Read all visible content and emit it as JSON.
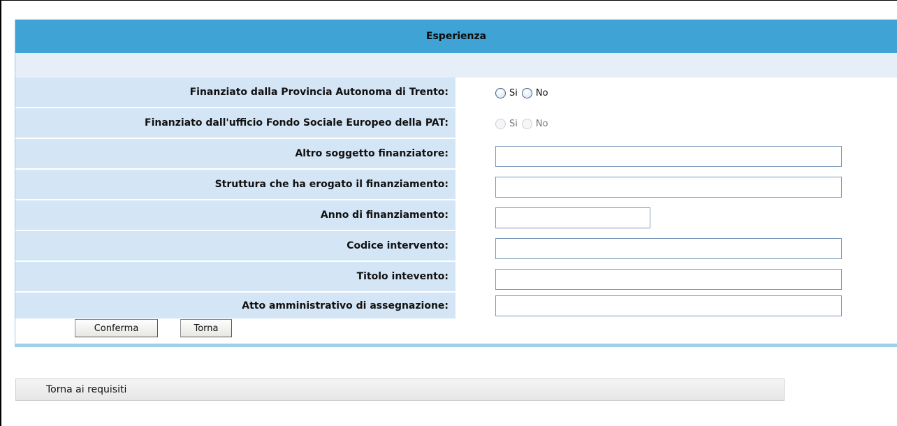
{
  "section": {
    "title": "Esperienza"
  },
  "fields": [
    {
      "label": "Finanziato dalla Provincia Autonoma di Trento:",
      "type": "radio",
      "options": [
        "Si",
        "No"
      ],
      "enabled": true
    },
    {
      "label": "Finanziato dall'ufficio Fondo Sociale Europeo della PAT:",
      "type": "radio",
      "options": [
        "Si",
        "No"
      ],
      "enabled": false
    },
    {
      "label": "Altro soggetto finanziatore:",
      "type": "text",
      "value": ""
    },
    {
      "label": "Struttura che ha erogato il finanziamento:",
      "type": "text",
      "value": ""
    },
    {
      "label": "Anno di finanziamento:",
      "type": "text",
      "value": ""
    },
    {
      "label": "Codice intervento:",
      "type": "text",
      "value": ""
    },
    {
      "label": "Titolo intevento:",
      "type": "text",
      "value": ""
    },
    {
      "label": "Atto amministrativo di assegnazione:",
      "type": "text",
      "value": ""
    }
  ],
  "buttons": {
    "confirm": "Conferma",
    "back": "Torna"
  },
  "footer": {
    "back_to_requirements": "Torna ai requisiti"
  },
  "colors": {
    "header": "#3fa3d5",
    "label_bg": "#d4e5f5",
    "sub_header": "#e6eff8"
  }
}
